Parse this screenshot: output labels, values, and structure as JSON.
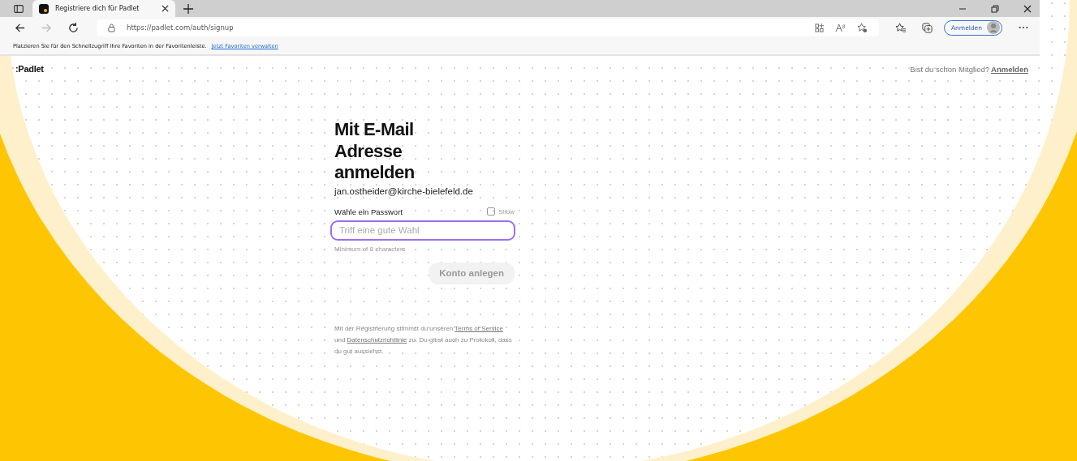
{
  "browser": {
    "tab": {
      "title": "Registriere dich für Padlet",
      "selected": true
    },
    "address": "https://padlet.com/auth/signup",
    "profile_button": "Anmelden",
    "favorites_bar": {
      "message": "Platzieren Sie für den Schnellzugriff Ihre Favoriten in der Favoritenleiste.",
      "link": "Jetzt Favoriten verwalten"
    }
  },
  "header": {
    "logo": ":Padlet",
    "prompt": "Bist du schon Mitglied?",
    "login_link": "Anmelden"
  },
  "form": {
    "title": "Mit E-Mail Adresse anmelden",
    "email": "jan.ostheider@kirche-bielefeld.de",
    "password_label": "Wähle ein Passwort",
    "show_label": "Show",
    "show_checked": false,
    "password_placeholder": "Triff eine gute Wahl",
    "hint": "Minimum of 8 characters",
    "submit": "Konto anlegen",
    "submit_disabled": true
  },
  "legal": [
    {
      "text": "Mit der Registrierung stimmst du unseren ",
      "link": false
    },
    {
      "text": "Terms of Service",
      "link": true
    },
    {
      "text": " und ",
      "link": false
    },
    {
      "text": "Datenschutzrichtlinie",
      "link": true
    },
    {
      "text": " zu. Du gibst auch zu Protokoll, dass du gut aussiehst.",
      "link": false
    }
  ]
}
